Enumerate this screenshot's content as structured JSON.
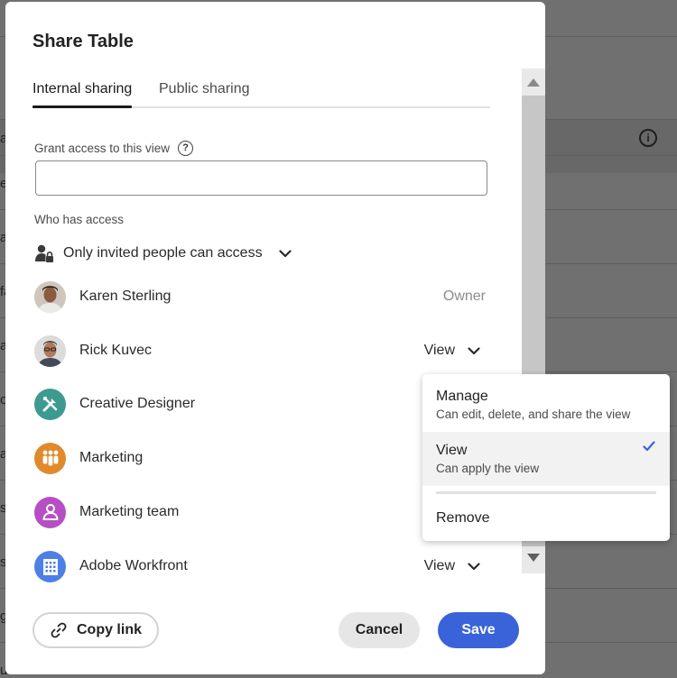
{
  "background": {
    "fragments": [
      "a",
      "e",
      "a",
      "fa",
      "a",
      "o",
      "a",
      "s",
      "s",
      "g",
      "u"
    ]
  },
  "dialog": {
    "title": "Share Table",
    "tabs": [
      {
        "label": "Internal sharing",
        "active": true
      },
      {
        "label": "Public sharing",
        "active": false
      }
    ],
    "grant_label": "Grant access to this view",
    "grant_value": "",
    "who_label": "Who has access",
    "access_mode": "Only invited people can access",
    "people": [
      {
        "name": "Karen Sterling",
        "role": "Owner",
        "avatar": "photo"
      },
      {
        "name": "Rick Kuvec",
        "role": "View",
        "avatar": "photo"
      },
      {
        "name": "Creative Designer",
        "role": "",
        "avatar": "tools-icon",
        "color": "#3d9a91"
      },
      {
        "name": "Marketing",
        "role": "",
        "avatar": "group-icon",
        "color": "#e08a2c"
      },
      {
        "name": "Marketing team",
        "role": "",
        "avatar": "user-icon",
        "color": "#b64fc4"
      },
      {
        "name": "Adobe Workfront",
        "role": "View",
        "avatar": "building-icon",
        "color": "#4d7fe8"
      }
    ],
    "copy_link_label": "Copy link",
    "cancel_label": "Cancel",
    "save_label": "Save"
  },
  "menu": {
    "items": [
      {
        "label": "Manage",
        "description": "Can edit, delete, and share the view",
        "selected": false
      },
      {
        "label": "View",
        "description": "Can apply the view",
        "selected": true
      },
      {
        "label": "Remove",
        "description": "",
        "selected": false
      }
    ]
  },
  "colors": {
    "accent": "#3b63d9",
    "check": "#3b63d9"
  }
}
